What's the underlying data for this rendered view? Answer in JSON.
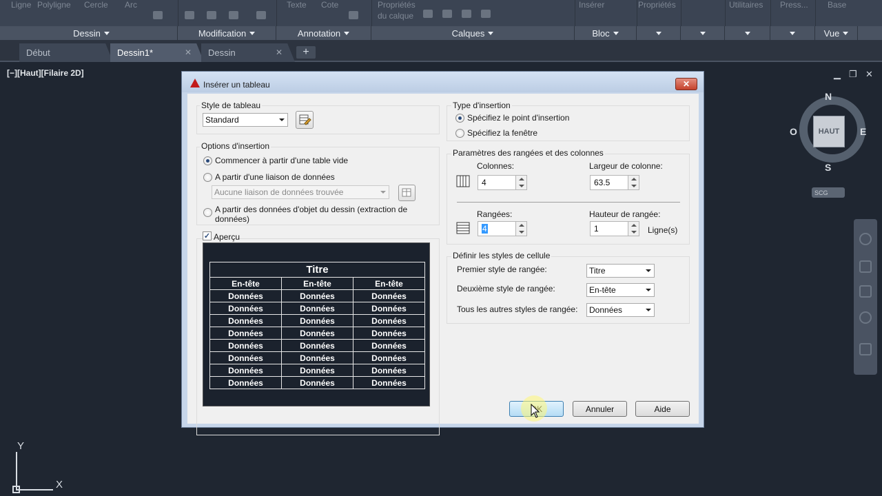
{
  "ribbon": {
    "top_labels": [
      "Ligne",
      "Polyligne",
      "Cercle",
      "Arc",
      "Texte",
      "Cote",
      "Propriétés",
      "du calque",
      "Insérer",
      "Propriétés",
      "Utilitaires",
      "Press...",
      "Base"
    ],
    "panels": [
      "Dessin",
      "Modification",
      "Annotation",
      "Calques",
      "Bloc",
      "",
      "",
      "",
      "",
      "Vue"
    ]
  },
  "tabs": [
    {
      "label": "Début",
      "closable": false
    },
    {
      "label": "Dessin1*",
      "closable": true
    },
    {
      "label": "Dessin",
      "closable": true
    }
  ],
  "viewport": {
    "label": "[−][Haut][Filaire 2D]",
    "ucs_x": "X",
    "ucs_y": "Y"
  },
  "viewcube": {
    "face": "HAUT",
    "north": "N",
    "south": "S",
    "east": "E",
    "west": "O",
    "ucs_menu": "SCG"
  },
  "dialog": {
    "title": "Insérer un tableau",
    "table_style": {
      "label": "Style de tableau",
      "value": "Standard"
    },
    "insert_options": {
      "label": "Options d'insertion",
      "empty_table": "Commencer à partir d'une table vide",
      "data_link": "A partir d'une liaison de données",
      "data_link_placeholder": "Aucune liaison de données trouvée",
      "object_data_line1": "A partir des données d'objet du dessin (extraction de",
      "object_data_line2": "données)"
    },
    "preview": {
      "label": "Aperçu",
      "title": "Titre",
      "header": "En-tête",
      "data": "Données"
    },
    "insertion_type": {
      "label": "Type d'insertion",
      "point": "Spécifiez le point d'insertion",
      "window": "Spécifiez la fenêtre"
    },
    "rows_cols": {
      "label": "Paramètres des rangées et des colonnes",
      "columns_label": "Colonnes:",
      "columns_value": "4",
      "col_width_label": "Largeur de colonne:",
      "col_width_value": "63.5",
      "rows_label": "Rangées:",
      "rows_value": "4",
      "row_height_label": "Hauteur de rangée:",
      "row_height_value": "1",
      "row_height_unit": "Ligne(s)"
    },
    "cell_styles": {
      "label": "Définir les styles de cellule",
      "first_label": "Premier style de rangée:",
      "first_value": "Titre",
      "second_label": "Deuxième style de rangée:",
      "second_value": "En-tête",
      "other_label": "Tous les autres styles de rangée:",
      "other_value": "Données"
    },
    "buttons": {
      "ok": "OK",
      "cancel": "Annuler",
      "help": "Aide",
      "close": "✕"
    }
  }
}
